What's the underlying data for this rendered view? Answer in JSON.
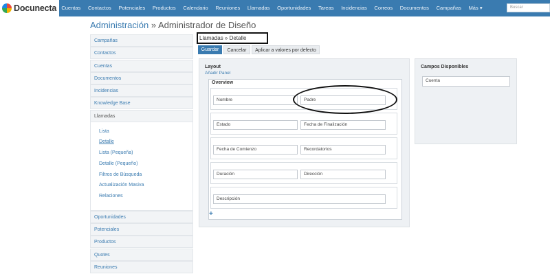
{
  "app": {
    "name": "Docunecta",
    "logo_icon": "docunecta-logo-icon"
  },
  "nav": {
    "items": [
      "Cuentas",
      "Contactos",
      "Potenciales",
      "Productos",
      "Calendario",
      "Reuniones",
      "Llamadas",
      "Oportunidades",
      "Tareas",
      "Incidencias",
      "Correos",
      "Documentos",
      "Campañas",
      "Más ▾"
    ]
  },
  "search": {
    "placeholder": "Buscar"
  },
  "page": {
    "title_link": "Administración",
    "title_sep": " » ",
    "title_rest": "Administrador de Diseño"
  },
  "sidebar": {
    "items": [
      "Campañas",
      "Contactos",
      "Cuentas",
      "Documentos",
      "Incidencias",
      "Knowledge Base",
      "Llamadas"
    ],
    "sub": [
      "Lista",
      "Detalle",
      "Lista (Pequeña)",
      "Detalle (Pequeño)",
      "Filtros de Búsqueda",
      "Actualización Masiva",
      "Relaciones"
    ],
    "items_after": [
      "Oportunidades",
      "Potenciales",
      "Productos",
      "Quotes",
      "Reuniones"
    ]
  },
  "breadcrumb": "Llamadas » Detalle",
  "toolbar": {
    "save": "Guardar",
    "cancel": "Cancelar",
    "restore": "Aplicar a valores por defecto"
  },
  "layout": {
    "title": "Layout",
    "add_panel": "Añadir Panel",
    "panel_title": "Overview",
    "rows": [
      [
        "Nombre",
        "Padre"
      ],
      [
        "Estado",
        "Fecha de Finalización"
      ],
      [
        "Fecha de Comienzo",
        "Recordatorios"
      ],
      [
        "Duración",
        "Dirección"
      ],
      [
        "Descripción"
      ]
    ],
    "add_row": "+"
  },
  "available": {
    "title": "Campos Disponibles",
    "fields": [
      "Cuenta"
    ]
  },
  "colors": {
    "accent": "#3a7bb0",
    "nav_bg": "#3a7bb0",
    "panel_bg": "#eef1f4"
  }
}
